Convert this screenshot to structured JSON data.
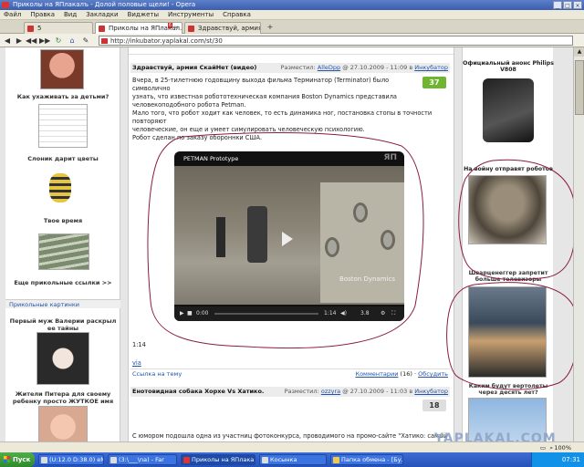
{
  "window": {
    "title": "Приколы на ЯПлакалъ - Долой половые щели! - Opera",
    "buttons": [
      "_",
      "□",
      "×"
    ]
  },
  "menu": [
    "Файл",
    "Правка",
    "Вид",
    "Закладки",
    "Виджеты",
    "Инструменты",
    "Справка"
  ],
  "tabs": [
    {
      "label": "5",
      "active": false
    },
    {
      "label": "Приколы на ЯПлакал...",
      "active": true,
      "badge": "6"
    },
    {
      "label": "Здравствуй, армия ...",
      "active": false
    }
  ],
  "address": {
    "url": "http://inkubator.yaplakal.com/st/30"
  },
  "left": {
    "items": [
      "Как ухаживать за детьми?",
      "Слоник дарит цветы",
      "Твое время",
      "Еще прикольные ссылки >>"
    ],
    "section_header": "Прикольные картинки",
    "pictures": [
      "Первый муж Валерии раскрыл ее тайны",
      "Жители Питера для своему ребенку просто ЖУТКОЕ имя"
    ]
  },
  "post1": {
    "title": "Здравствуй, армия СкайНет (видео)",
    "posted_label": "Разместил:",
    "author": "AlleDpp",
    "date": "@ 27.10.2009 - 11:09",
    "section_prefix": "в",
    "section": "Инкубатор",
    "score": "37",
    "body": [
      "Вчера, в 25-тилетнюю годовщину выхода фильма Терминатор (Terminator) было символично",
      "узнать, что известная робототехническая компания Boston Dynamics представила",
      "человекоподобного робота Petman.",
      "Мало того, что робот ходит как человек, то есть динамика ног, постановка стопы в точности повторяют",
      "человеческие, он еще и умеет симулировать человеческую психологию.",
      "Робот сделан по заказу обороннки США."
    ],
    "video": {
      "title": "PETMAN Prototype",
      "watermark": "Boston Dynamics",
      "time_current": "0:00",
      "time_total": "1:14",
      "quality": "3.8"
    },
    "duration": "1:14",
    "via": "via",
    "link": "Ссылка на тему",
    "comments": "Комментарии",
    "comments_count": "(16)",
    "discuss": "Обсудить"
  },
  "post2": {
    "title": "Енотовидная собака Хорхе Vs Хатико.",
    "posted_label": "Разместил:",
    "author": "ozzyra",
    "date": "@ 27.10.2009 - 11:03",
    "section_prefix": "в",
    "section": "Инкубатор",
    "score": "18",
    "body": "С юмором подошла одна из участниц фотоконкурса, проводимого на промо-сайте \"Хатико: самый"
  },
  "right": {
    "items": [
      "Официальный анонс Philips V808",
      "На войну отправят роботов",
      "Шварценеггер запретит больше телевизоры",
      "Каким будут вертолеты через десять лет?"
    ]
  },
  "status": {
    "zoom": "100%"
  },
  "watermark": "YAPLAKAL.COM",
  "taskbar": {
    "start": "Пуск",
    "tasks": [
      "(U:12.0 D:38.0) eMul...",
      "(3:\\___\\na) - Far",
      "Приколы на ЯПлака...",
      "Косынка",
      "Папка обмена - [Бу..."
    ],
    "clock": "07:31"
  },
  "colors": {
    "score1": "#6fb52f",
    "score2": "#dedede",
    "annotation": "#8a1c3c",
    "taskbar": "#2552b8"
  }
}
